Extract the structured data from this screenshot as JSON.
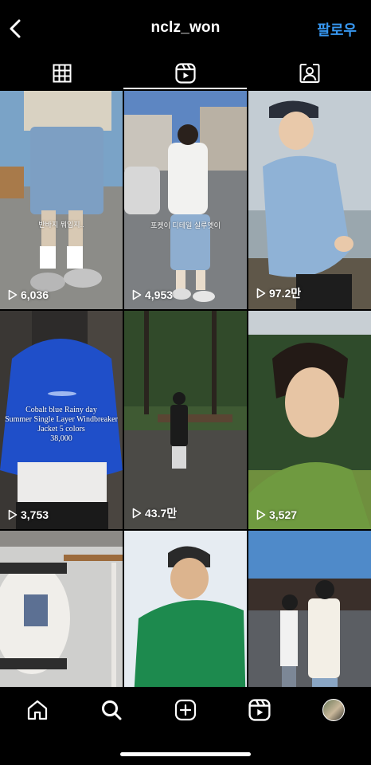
{
  "header": {
    "username": "nclz_won",
    "follow_label": "팔로우",
    "back_icon": "chevron-left-icon"
  },
  "tabs": [
    {
      "name": "grid",
      "icon": "grid-icon",
      "active": false
    },
    {
      "name": "reels",
      "icon": "reels-icon",
      "active": true
    },
    {
      "name": "tagged",
      "icon": "tagged-person-icon",
      "active": false
    }
  ],
  "reels": [
    {
      "views": "6,036",
      "overlay": "반바지 뭐입지.."
    },
    {
      "views": "4,953",
      "overlay": "포켓이 디테일 실루엣이"
    },
    {
      "views": "97.2만",
      "overlay": ""
    },
    {
      "views": "3,753",
      "overlay": "Cobalt blue Rainy day\nSummer Single Layer Windbreaker Jacket 5 colors\n38,000"
    },
    {
      "views": "43.7만",
      "overlay": ""
    },
    {
      "views": "3,527",
      "overlay": ""
    },
    {
      "views": "",
      "overlay": ""
    },
    {
      "views": "",
      "overlay": ""
    },
    {
      "views": "",
      "overlay": ""
    }
  ],
  "bottom_nav": [
    {
      "name": "home",
      "icon": "home-icon"
    },
    {
      "name": "search",
      "icon": "search-icon"
    },
    {
      "name": "create",
      "icon": "add-square-icon"
    },
    {
      "name": "reels",
      "icon": "reels-icon"
    },
    {
      "name": "profile",
      "icon": "avatar"
    }
  ],
  "colors": {
    "background": "#000000",
    "accent": "#3797f0",
    "text": "#ffffff"
  }
}
